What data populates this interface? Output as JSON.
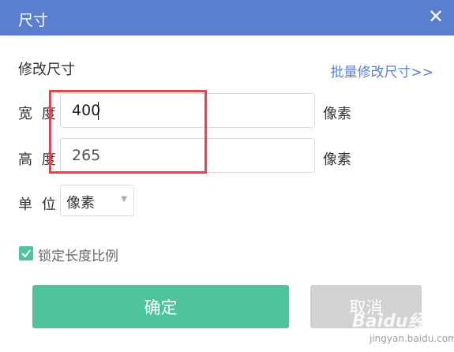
{
  "dialog": {
    "title": "尺寸",
    "close_icon": "close-icon",
    "title_bar_color": "#5b7fcf"
  },
  "resize": {
    "section_title": "修改尺寸",
    "batch_link": "批量修改尺寸>>",
    "width_label": "宽 度",
    "width_value": "400",
    "width_unit": "像素",
    "height_label": "高 度",
    "height_value": "265",
    "height_unit": "像素",
    "unit_label": "单 位",
    "unit_select_value": "像素"
  },
  "lock_ratio": {
    "checked": true,
    "label": "锁定长度比例"
  },
  "buttons": {
    "ok_label": "确定",
    "cancel_label": "取消",
    "ok_color": "#4ec49c",
    "cancel_color": "#d2d2d2"
  },
  "annotation": {
    "highlight_color": "#e0484c"
  },
  "watermark": {
    "brand": "Baidu经验",
    "url": "jingyan.baidu.com"
  }
}
